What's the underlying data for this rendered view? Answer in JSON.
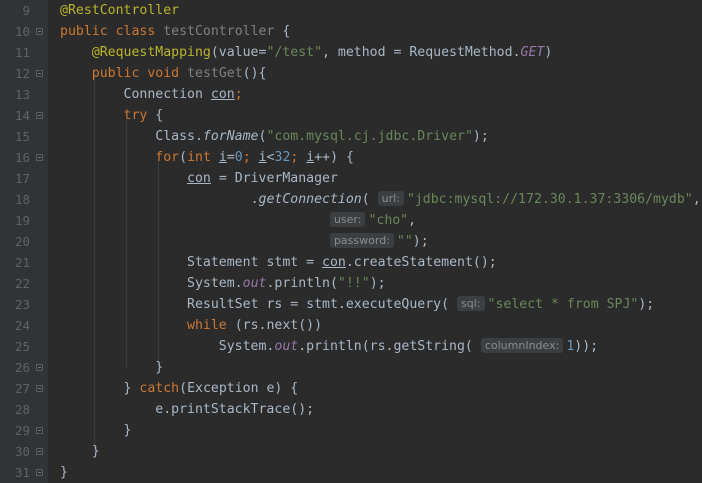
{
  "editor": {
    "line_numbers": [
      "9",
      "10",
      "11",
      "12",
      "13",
      "14",
      "15",
      "16",
      "17",
      "18",
      "19",
      "20",
      "21",
      "22",
      "23",
      "24",
      "25",
      "26",
      "27",
      "28",
      "29",
      "30",
      "31"
    ],
    "code": {
      "l9": "@RestController",
      "l10_kw": "public class",
      "l10_name": "testController",
      "l10_brace": "{",
      "l11_ann": "@RequestMapping",
      "l11_a": "(value=",
      "l11_str": "\"/test\"",
      "l11_b": ", method = RequestMethod.",
      "l11_get": "GET",
      "l11_c": ")",
      "l12_kw": "public void",
      "l12_name": "testGet",
      "l12_rest": "(){",
      "l13_type": "Connection ",
      "l13_var": "con",
      "l13_semi": ";",
      "l14_kw": "try",
      "l14_brace": " {",
      "l15_a": "Class.",
      "l15_m": "forName",
      "l15_b": "(",
      "l15_str": "\"com.mysql.cj.jdbc.Driver\"",
      "l15_c": ");",
      "l16_kw": "for",
      "l16_a": "(",
      "l16_int": "int",
      "l16_i1": "i",
      "l16_b": "=",
      "l16_n0": "0",
      "l16_c": "; ",
      "l16_i2": "i",
      "l16_d": "<",
      "l16_n32": "32",
      "l16_e": "; ",
      "l16_i3": "i",
      "l16_f": "++) {",
      "l17_var": "con",
      "l17_rest": " = DriverManager",
      "l18_dot": ".",
      "l18_m": "getConnection",
      "l18_paren": "(",
      "l18_hint": "url:",
      "l18_str": "\"jdbc:mysql://172.30.1.37:3306/mydb\"",
      "l18_comma": ",",
      "l19_hint": "user:",
      "l19_str": "\"cho\"",
      "l19_comma": ",",
      "l20_hint": "password:",
      "l20_str": "\"\"",
      "l20_end": ");",
      "l21_a": "Statement stmt = ",
      "l21_var": "con",
      "l21_b": ".createStatement();",
      "l22_a": "System.",
      "l22_out": "out",
      "l22_b": ".println(",
      "l22_str": "\"!!\"",
      "l22_c": ");",
      "l23_a": "ResultSet rs = stmt.executeQuery(",
      "l23_hint": "sql:",
      "l23_str": "\"select * from SPJ\"",
      "l23_c": ");",
      "l24_kw": "while",
      "l24_rest": " (rs.next())",
      "l25_a": "System.",
      "l25_out": "out",
      "l25_b": ".println(rs.getString(",
      "l25_hint": "columnIndex:",
      "l25_num": "1",
      "l25_c": "));",
      "l26": "}",
      "l27_a": "} ",
      "l27_kw": "catch",
      "l27_b": "(Exception e) {",
      "l28": "e.printStackTrace();",
      "l29": "}",
      "l30": "}",
      "l31": "}"
    }
  },
  "colors": {
    "background": "#2b2b2b",
    "gutter": "#313335",
    "keyword": "#cc7832",
    "annotation": "#bbb529",
    "string": "#6a8759",
    "number": "#6897bb",
    "static_field": "#9876aa",
    "text": "#a9b7c6",
    "line_number": "#606366"
  }
}
